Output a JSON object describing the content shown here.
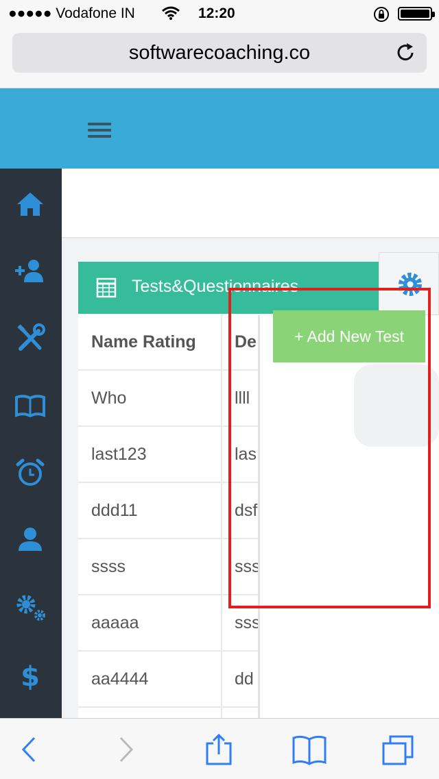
{
  "status_bar": {
    "carrier": "●●●●● Vodafone IN",
    "time": "12:20",
    "icons": [
      "wifi-icon",
      "orientation-lock-icon",
      "battery-icon"
    ]
  },
  "browser": {
    "url": "softwarecoaching.co",
    "reload_icon": "reload-icon"
  },
  "header": {
    "menu_icon": "hamburger-menu-icon",
    "color": "#3aaad9"
  },
  "sidebar": {
    "color": "#2b333c",
    "icon_color": "#2e8fd6",
    "items": [
      {
        "icon": "home-icon"
      },
      {
        "icon": "add-user-icon"
      },
      {
        "icon": "tools-icon"
      },
      {
        "icon": "book-icon"
      },
      {
        "icon": "alarm-clock-icon"
      },
      {
        "icon": "user-icon"
      },
      {
        "icon": "settings-gears-icon"
      },
      {
        "icon": "dollar-icon"
      }
    ]
  },
  "panel": {
    "title": "Tests&Questionnaires",
    "icon": "table-icon",
    "color": "#37bc9b",
    "settings_icon": "gear-icon"
  },
  "table": {
    "headers": [
      "Name Rating",
      "De"
    ],
    "rows": [
      [
        "Who",
        "llll"
      ],
      [
        "last123",
        "las"
      ],
      [
        "ddd11",
        "dsf"
      ],
      [
        "ssss",
        "sss"
      ],
      [
        "aaaaa",
        "sss"
      ],
      [
        "aa4444",
        "dd"
      ]
    ]
  },
  "add_button": {
    "label": "+ Add New Test",
    "color": "#8bd377"
  },
  "toolbar": {
    "icons": [
      "back-icon",
      "forward-icon",
      "share-icon",
      "bookmarks-icon",
      "tabs-icon"
    ],
    "tint": "#2f7ef6"
  },
  "highlight_color": "#e0201f"
}
